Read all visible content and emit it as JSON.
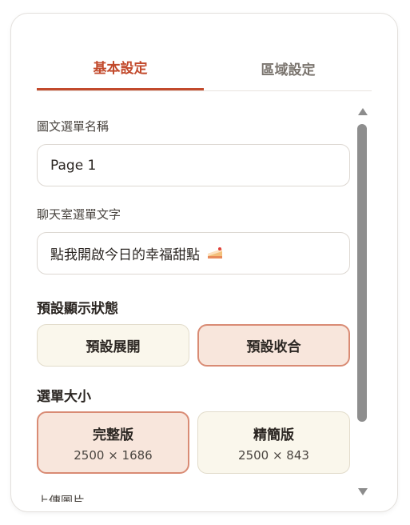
{
  "tabs": {
    "basic": "基本設定",
    "area": "區域設定"
  },
  "menu_name": {
    "label": "圖文選單名稱",
    "value": "Page 1"
  },
  "chat_text": {
    "label": "聊天室選單文字",
    "value": "點我開啟今日的幸福甜點"
  },
  "default_state": {
    "title": "預設顯示狀態",
    "expand": "預設展開",
    "collapse": "預設收合",
    "selected": "collapse"
  },
  "menu_size": {
    "title": "選單大小",
    "full": {
      "label": "完整版",
      "size": "2500 × 1686"
    },
    "compact": {
      "label": "精簡版",
      "size": "2500 × 843"
    },
    "selected": "full"
  },
  "upload": {
    "label": "上傳圖片"
  },
  "colors": {
    "accent": "#c24a2c",
    "selected_bg": "#f8e6dc",
    "option_bg": "#faf7ec"
  },
  "icons": {
    "cake": "cake-slice-icon"
  }
}
